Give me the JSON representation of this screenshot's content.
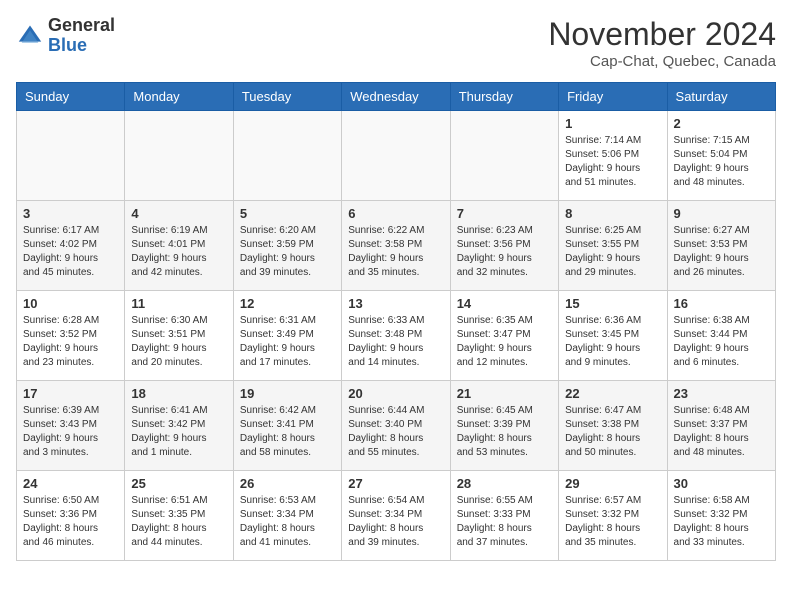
{
  "header": {
    "logo_general": "General",
    "logo_blue": "Blue",
    "month": "November 2024",
    "location": "Cap-Chat, Quebec, Canada"
  },
  "days_of_week": [
    "Sunday",
    "Monday",
    "Tuesday",
    "Wednesday",
    "Thursday",
    "Friday",
    "Saturday"
  ],
  "weeks": [
    [
      {
        "day": "",
        "info": ""
      },
      {
        "day": "",
        "info": ""
      },
      {
        "day": "",
        "info": ""
      },
      {
        "day": "",
        "info": ""
      },
      {
        "day": "",
        "info": ""
      },
      {
        "day": "1",
        "info": "Sunrise: 7:14 AM\nSunset: 5:06 PM\nDaylight: 9 hours\nand 51 minutes."
      },
      {
        "day": "2",
        "info": "Sunrise: 7:15 AM\nSunset: 5:04 PM\nDaylight: 9 hours\nand 48 minutes."
      }
    ],
    [
      {
        "day": "3",
        "info": "Sunrise: 6:17 AM\nSunset: 4:02 PM\nDaylight: 9 hours\nand 45 minutes."
      },
      {
        "day": "4",
        "info": "Sunrise: 6:19 AM\nSunset: 4:01 PM\nDaylight: 9 hours\nand 42 minutes."
      },
      {
        "day": "5",
        "info": "Sunrise: 6:20 AM\nSunset: 3:59 PM\nDaylight: 9 hours\nand 39 minutes."
      },
      {
        "day": "6",
        "info": "Sunrise: 6:22 AM\nSunset: 3:58 PM\nDaylight: 9 hours\nand 35 minutes."
      },
      {
        "day": "7",
        "info": "Sunrise: 6:23 AM\nSunset: 3:56 PM\nDaylight: 9 hours\nand 32 minutes."
      },
      {
        "day": "8",
        "info": "Sunrise: 6:25 AM\nSunset: 3:55 PM\nDaylight: 9 hours\nand 29 minutes."
      },
      {
        "day": "9",
        "info": "Sunrise: 6:27 AM\nSunset: 3:53 PM\nDaylight: 9 hours\nand 26 minutes."
      }
    ],
    [
      {
        "day": "10",
        "info": "Sunrise: 6:28 AM\nSunset: 3:52 PM\nDaylight: 9 hours\nand 23 minutes."
      },
      {
        "day": "11",
        "info": "Sunrise: 6:30 AM\nSunset: 3:51 PM\nDaylight: 9 hours\nand 20 minutes."
      },
      {
        "day": "12",
        "info": "Sunrise: 6:31 AM\nSunset: 3:49 PM\nDaylight: 9 hours\nand 17 minutes."
      },
      {
        "day": "13",
        "info": "Sunrise: 6:33 AM\nSunset: 3:48 PM\nDaylight: 9 hours\nand 14 minutes."
      },
      {
        "day": "14",
        "info": "Sunrise: 6:35 AM\nSunset: 3:47 PM\nDaylight: 9 hours\nand 12 minutes."
      },
      {
        "day": "15",
        "info": "Sunrise: 6:36 AM\nSunset: 3:45 PM\nDaylight: 9 hours\nand 9 minutes."
      },
      {
        "day": "16",
        "info": "Sunrise: 6:38 AM\nSunset: 3:44 PM\nDaylight: 9 hours\nand 6 minutes."
      }
    ],
    [
      {
        "day": "17",
        "info": "Sunrise: 6:39 AM\nSunset: 3:43 PM\nDaylight: 9 hours\nand 3 minutes."
      },
      {
        "day": "18",
        "info": "Sunrise: 6:41 AM\nSunset: 3:42 PM\nDaylight: 9 hours\nand 1 minute."
      },
      {
        "day": "19",
        "info": "Sunrise: 6:42 AM\nSunset: 3:41 PM\nDaylight: 8 hours\nand 58 minutes."
      },
      {
        "day": "20",
        "info": "Sunrise: 6:44 AM\nSunset: 3:40 PM\nDaylight: 8 hours\nand 55 minutes."
      },
      {
        "day": "21",
        "info": "Sunrise: 6:45 AM\nSunset: 3:39 PM\nDaylight: 8 hours\nand 53 minutes."
      },
      {
        "day": "22",
        "info": "Sunrise: 6:47 AM\nSunset: 3:38 PM\nDaylight: 8 hours\nand 50 minutes."
      },
      {
        "day": "23",
        "info": "Sunrise: 6:48 AM\nSunset: 3:37 PM\nDaylight: 8 hours\nand 48 minutes."
      }
    ],
    [
      {
        "day": "24",
        "info": "Sunrise: 6:50 AM\nSunset: 3:36 PM\nDaylight: 8 hours\nand 46 minutes."
      },
      {
        "day": "25",
        "info": "Sunrise: 6:51 AM\nSunset: 3:35 PM\nDaylight: 8 hours\nand 44 minutes."
      },
      {
        "day": "26",
        "info": "Sunrise: 6:53 AM\nSunset: 3:34 PM\nDaylight: 8 hours\nand 41 minutes."
      },
      {
        "day": "27",
        "info": "Sunrise: 6:54 AM\nSunset: 3:34 PM\nDaylight: 8 hours\nand 39 minutes."
      },
      {
        "day": "28",
        "info": "Sunrise: 6:55 AM\nSunset: 3:33 PM\nDaylight: 8 hours\nand 37 minutes."
      },
      {
        "day": "29",
        "info": "Sunrise: 6:57 AM\nSunset: 3:32 PM\nDaylight: 8 hours\nand 35 minutes."
      },
      {
        "day": "30",
        "info": "Sunrise: 6:58 AM\nSunset: 3:32 PM\nDaylight: 8 hours\nand 33 minutes."
      }
    ]
  ]
}
